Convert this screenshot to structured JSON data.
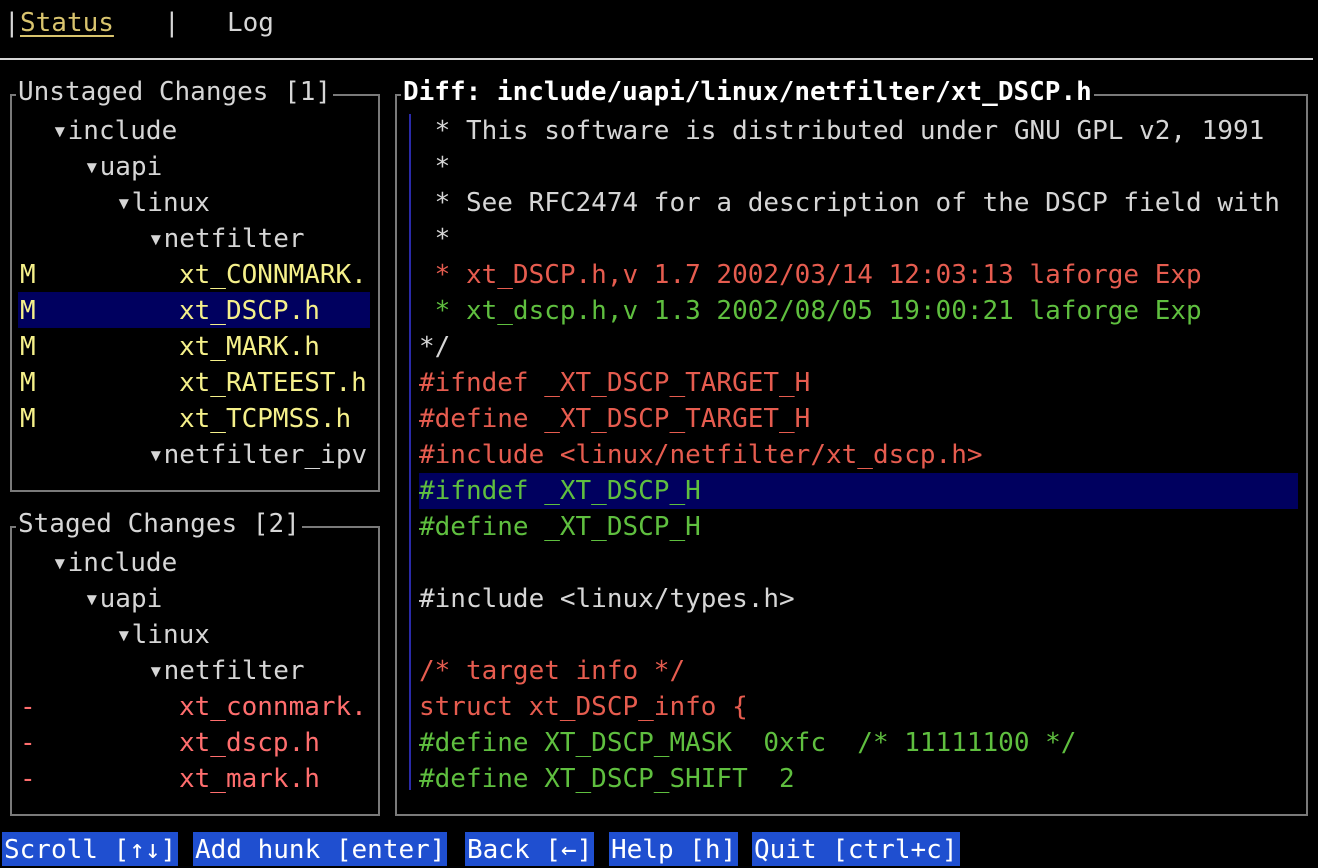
{
  "tabs": {
    "left_sep": "|",
    "status": "Status",
    "mid_sep": "|",
    "log": "Log"
  },
  "unstaged": {
    "title": "Unstaged Changes [1]",
    "rows": [
      {
        "status": "",
        "label": "▾include"
      },
      {
        "status": "",
        "label": "▾uapi"
      },
      {
        "status": "",
        "label": "▾linux"
      },
      {
        "status": "",
        "label": "▾netfilter"
      },
      {
        "status": "M",
        "label": "xt_CONNMARK."
      },
      {
        "status": "M",
        "label": "xt_DSCP.h"
      },
      {
        "status": "M",
        "label": "xt_MARK.h"
      },
      {
        "status": "M",
        "label": "xt_RATEEST.h"
      },
      {
        "status": "M",
        "label": "xt_TCPMSS.h"
      },
      {
        "status": "",
        "label": "▾netfilter_ipv"
      }
    ]
  },
  "staged": {
    "title": "Staged Changes [2]",
    "rows": [
      {
        "status": "",
        "label": "▾include"
      },
      {
        "status": "",
        "label": "▾uapi"
      },
      {
        "status": "",
        "label": "▾linux"
      },
      {
        "status": "",
        "label": "▾netfilter"
      },
      {
        "status": "-",
        "label": "xt_connmark."
      },
      {
        "status": "-",
        "label": "xt_dscp.h"
      },
      {
        "status": "-",
        "label": "xt_mark.h"
      }
    ]
  },
  "diff": {
    "title": "Diff: include/uapi/linux/netfilter/xt_DSCP.h",
    "lines": [
      " * This software is distributed under GNU GPL v2, 1991",
      " *",
      " * See RFC2474 for a description of the DSCP field with",
      " *",
      " * xt_DSCP.h,v 1.7 2002/03/14 12:03:13 laforge Exp",
      " * xt_dscp.h,v 1.3 2002/08/05 19:00:21 laforge Exp",
      "*/",
      "#ifndef _XT_DSCP_TARGET_H",
      "#define _XT_DSCP_TARGET_H",
      "#include <linux/netfilter/xt_dscp.h>",
      "#ifndef _XT_DSCP_H",
      "#define _XT_DSCP_H",
      "",
      "#include <linux/types.h>",
      "",
      "/* target info */",
      "struct xt_DSCP_info {",
      "#define XT_DSCP_MASK  0xfc  /* 11111100 */",
      "#define XT_DSCP_SHIFT  2"
    ]
  },
  "keys": {
    "scroll": "Scroll [↑↓]",
    "add_hunk": "Add hunk [enter]",
    "back": "Back [←]",
    "help": "Help [h]",
    "quit": "Quit [ctrl+c]"
  },
  "colors": {
    "accent_tab": "#d9c46e",
    "modified": "#f5f08a",
    "removed_line": "#e65c4f",
    "added_line": "#5fbf3f",
    "deleted_file": "#ff6e6e",
    "selection": "#00005f",
    "keybar": "#1f4fd0"
  }
}
